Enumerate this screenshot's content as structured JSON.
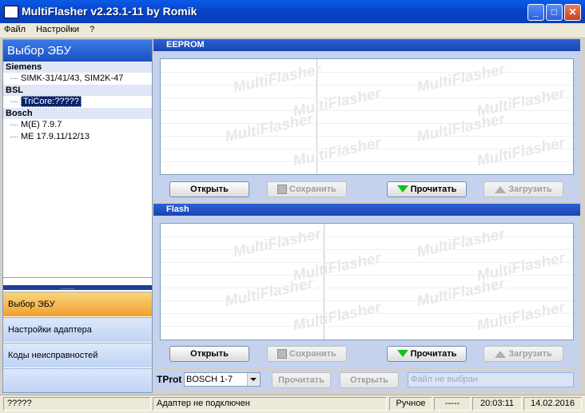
{
  "window": {
    "title": "MultiFlasher v2.23.1-11 by Romik",
    "min": "_",
    "max": "□",
    "close": "✕"
  },
  "menu": [
    "Файл",
    "Настройки",
    "?"
  ],
  "sidebar": {
    "header": "Выбор ЭБУ",
    "groups": [
      {
        "name": "Siemens",
        "items": [
          "SIMK-31/41/43, SIM2K-47"
        ]
      },
      {
        "name": "BSL",
        "items": [
          "TriCore:?????"
        ]
      },
      {
        "name": "Bosch",
        "items": [
          "M(E) 7.9.7",
          "ME 17.9.11/12/13"
        ]
      }
    ],
    "grip": "..........",
    "nav": [
      "Выбор ЭБУ",
      "Настройки адаптера",
      "Коды неисправностей"
    ]
  },
  "eeprom": {
    "title": "EEPROM",
    "open": "Открыть",
    "save": "Сохранить",
    "read": "Прочитать",
    "write": "Загрузить"
  },
  "flash": {
    "title": "Flash",
    "open": "Открыть",
    "save": "Сохранить",
    "read": "Прочитать",
    "write": "Загрузить"
  },
  "watermark": "MultiFlasher",
  "tprot": {
    "label": "TProt",
    "selected": "BOSCH 1-7",
    "read": "Прочитать",
    "open": "Открыть",
    "file_placeholder": "Файл не выбран"
  },
  "status": {
    "left": "?????",
    "adapter": "Адаптер не подключен",
    "mode": "Ручное",
    "dash": "-----",
    "time": "20:03:11",
    "date": "14.02.2016"
  }
}
